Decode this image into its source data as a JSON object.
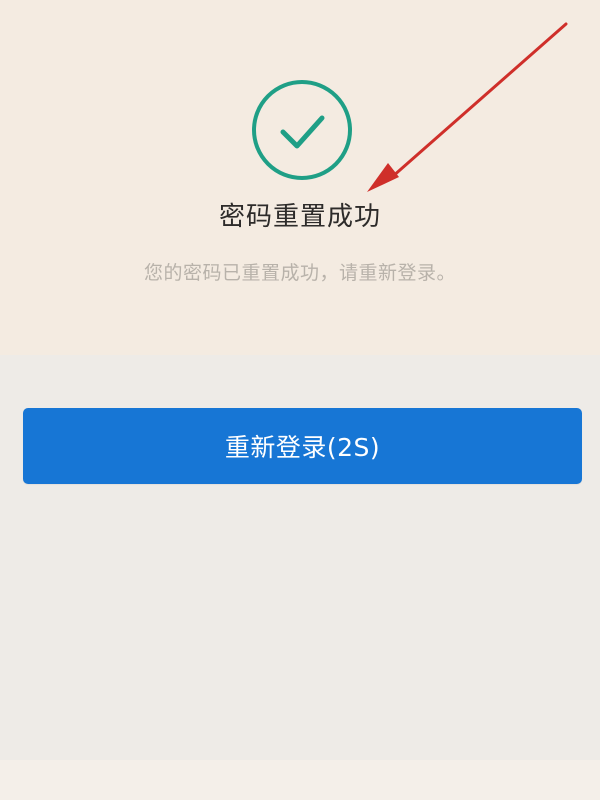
{
  "success": {
    "icon": "check-circle-icon",
    "title": "密码重置成功",
    "message": "您的密码已重置成功，请重新登录。"
  },
  "actions": {
    "relogin_label": "重新登录(2S)"
  },
  "colors": {
    "success": "#1f9f86",
    "button": "#1776d5",
    "annotation": "#cf2f2a"
  }
}
